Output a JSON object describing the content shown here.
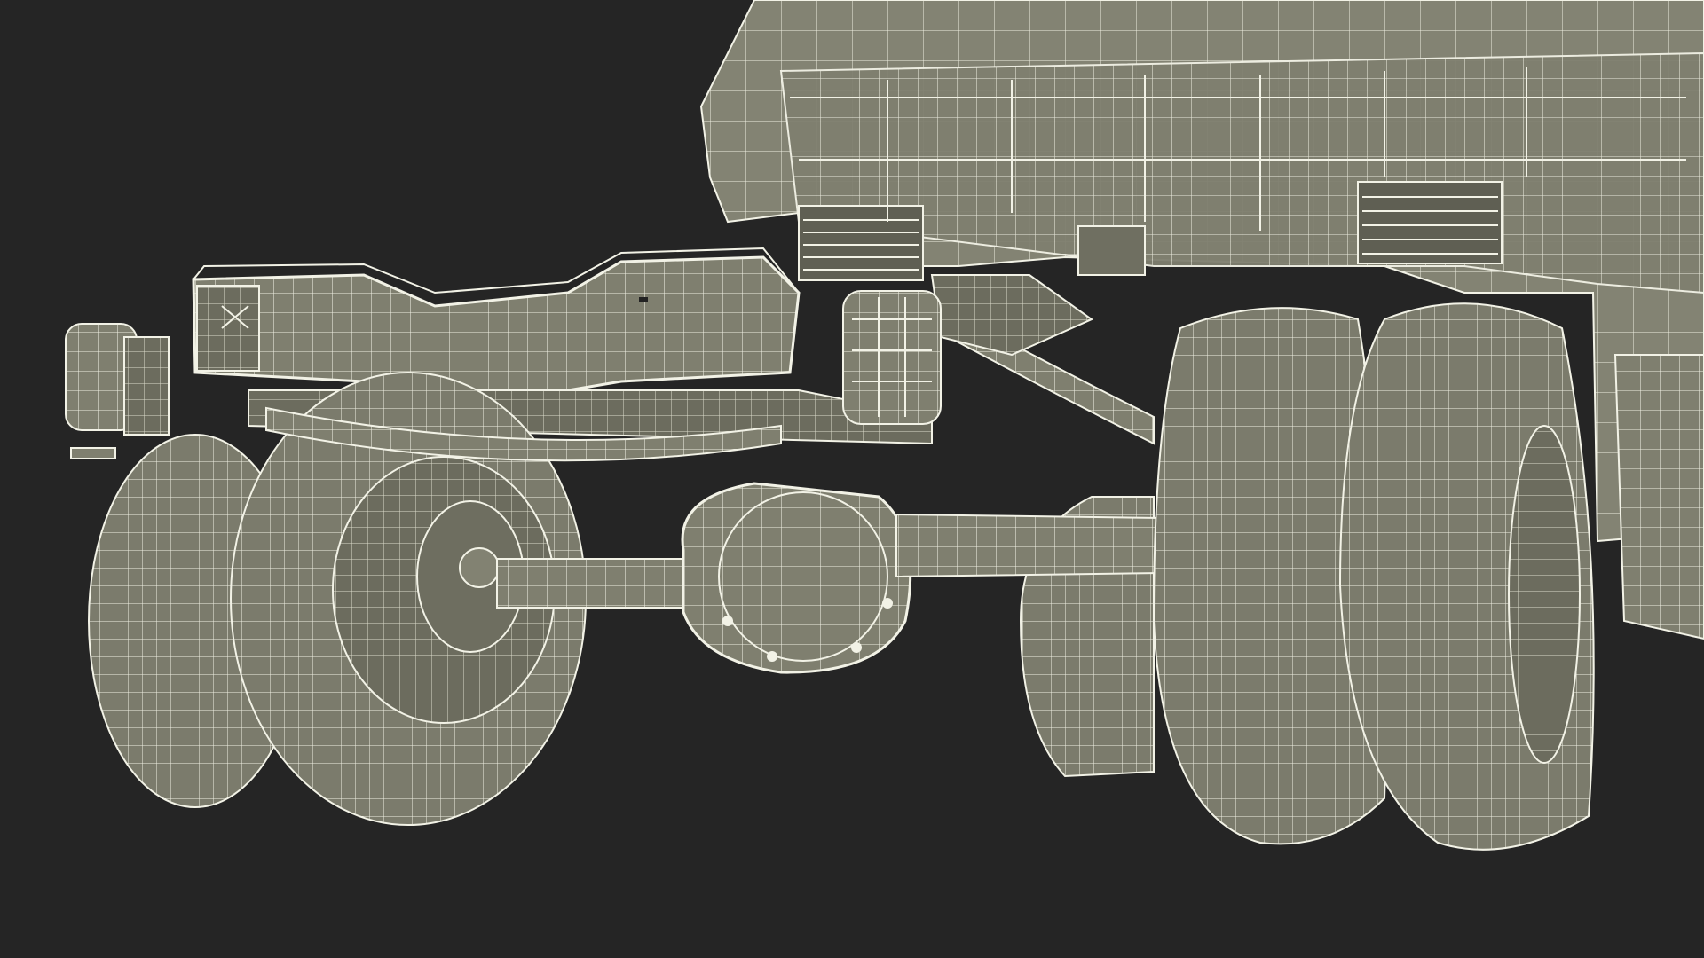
{
  "scene": {
    "description_visible_text": "",
    "colors": {
      "background": "#252525",
      "surface": "#7f7f6f",
      "surface_dark": "#6a6a5c",
      "surface_light": "#8c8c7c",
      "wire": "#f2f2e6",
      "wire_dim": "#d8d8c8"
    },
    "objects": [
      "truck-body-rear",
      "chassis-frame-rail",
      "leaf-spring",
      "differential-housing",
      "axle-tube",
      "left-dual-wheels",
      "right-dual-wheels",
      "rear-light-left",
      "rear-light-center"
    ]
  }
}
